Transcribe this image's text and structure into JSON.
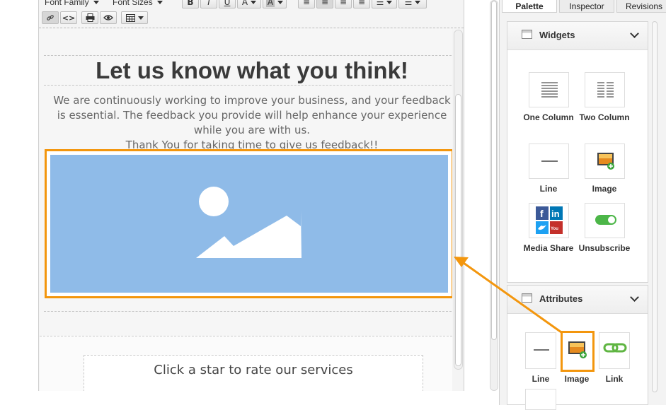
{
  "toolbar": {
    "font_family": "Font Family",
    "font_sizes": "Font Sizes",
    "bold": "B",
    "italic": "I",
    "underline": "U",
    "font_color": "A",
    "bg_color": "A"
  },
  "content": {
    "headline": "Let us know what you think!",
    "body": "We are continuously working to improve your business, and your feedback is essential. The feedback you provide will help enhance your experience while you are with us.",
    "thanks": "Thank You for taking time to give us feedback!!",
    "rate_prompt": "Click a star to rate our services"
  },
  "palette": {
    "tabs": [
      "Palette",
      "Inspector",
      "Revisions"
    ],
    "widgets_title": "Widgets",
    "widgets": [
      {
        "label": "One Column",
        "icon": "one-column-icon"
      },
      {
        "label": "Two Column",
        "icon": "two-column-icon"
      },
      {
        "label": "Line",
        "icon": "line-icon"
      },
      {
        "label": "Image",
        "icon": "image-add-icon"
      },
      {
        "label": "Media Share",
        "icon": "social-media-icon"
      },
      {
        "label": "Unsubscribe",
        "icon": "toggle-icon"
      }
    ],
    "attributes_title": "Attributes",
    "attributes": [
      {
        "label": "Line",
        "icon": "line-icon"
      },
      {
        "label": "Image",
        "icon": "image-add-icon"
      },
      {
        "label": "Link",
        "icon": "chain-link-icon"
      }
    ]
  },
  "colors": {
    "highlight": "#f3960d",
    "image_placeholder": "#8fbbe8",
    "toggle_green": "#4cb648",
    "link_green": "#5fb542"
  }
}
